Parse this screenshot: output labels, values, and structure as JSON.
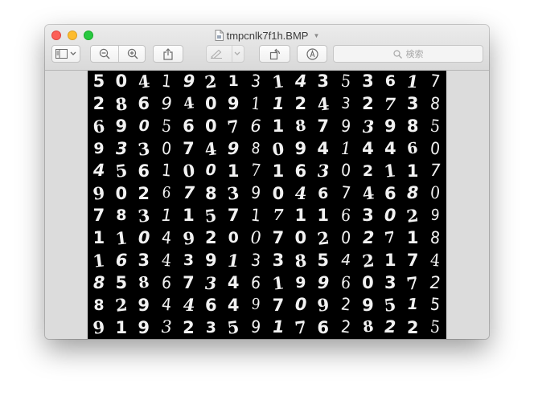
{
  "window": {
    "title": "tmpcnlk7f1h.BMP",
    "traffic_lights": {
      "close": "#fc5f57",
      "minimize": "#fdbc2e",
      "zoom": "#28c840"
    }
  },
  "toolbar": {
    "buttons": [
      "sidebar-icon",
      "chevron-down-icon",
      "zoom-out-icon",
      "zoom-in-icon",
      "share-icon",
      "markup-pen-icon",
      "chevron-down-icon",
      "rotate-icon",
      "annotate-icon"
    ],
    "search_placeholder": "検索"
  },
  "image": {
    "description_colors": {
      "background": "#000000",
      "digits": "#ffffff"
    },
    "rows": [
      "5041921314353617",
      "2869409112432738",
      "6905607618793985",
      "9330749809414460",
      "4561001716302117",
      "9026783904674680",
      "7831157171163029",
      "1104920070202718",
      "1634391338542174",
      "8586734619960372",
      "8294464970929515",
      "9193235917628225"
    ]
  }
}
